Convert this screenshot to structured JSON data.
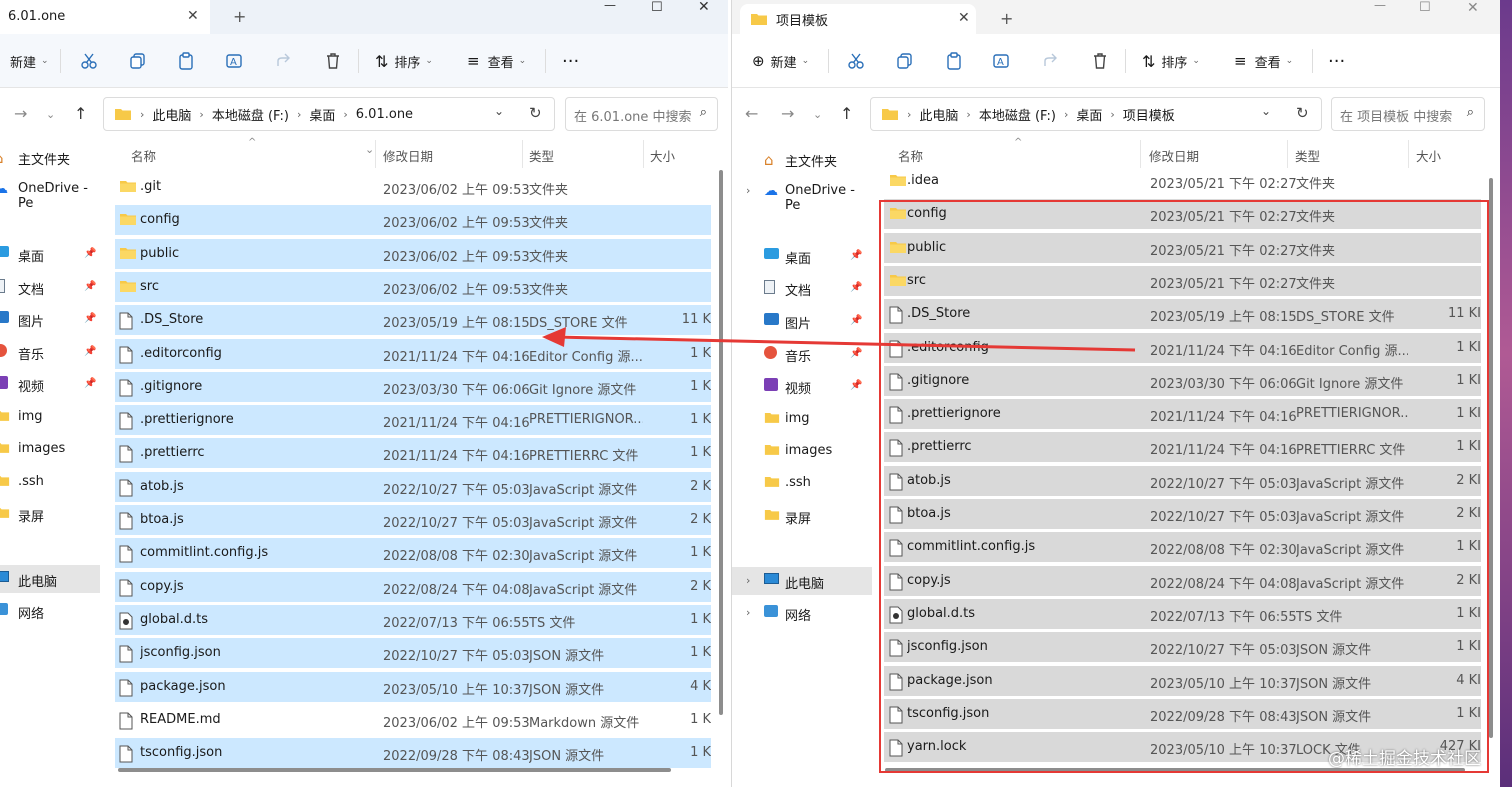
{
  "left": {
    "tab_title": "6.01.one",
    "toolbar": {
      "new": "新建",
      "sort": "排序",
      "view": "查看"
    },
    "breadcrumb": [
      "此电脑",
      "本地磁盘 (F:)",
      "桌面",
      "6.01.one"
    ],
    "search_placeholder": "在 6.01.one 中搜索",
    "sidebar": [
      {
        "label": "主文件夹",
        "icon": "home-icon",
        "pinned": false
      },
      {
        "label": "OneDrive - Pe",
        "icon": "cloud-icon",
        "pinned": false
      },
      {
        "label": "桌面",
        "icon": "desktop-icon",
        "pinned": true
      },
      {
        "label": "文档",
        "icon": "document-icon",
        "pinned": true
      },
      {
        "label": "图片",
        "icon": "picture-icon",
        "pinned": true
      },
      {
        "label": "音乐",
        "icon": "music-icon",
        "pinned": true
      },
      {
        "label": "视频",
        "icon": "video-icon",
        "pinned": true
      },
      {
        "label": "img",
        "icon": "folder-icon",
        "pinned": false
      },
      {
        "label": "images",
        "icon": "folder-icon",
        "pinned": false
      },
      {
        "label": ".ssh",
        "icon": "folder-icon",
        "pinned": false
      },
      {
        "label": "录屏",
        "icon": "folder-icon",
        "pinned": false
      },
      {
        "label": "此电脑",
        "icon": "computer-icon",
        "pinned": false
      },
      {
        "label": "网络",
        "icon": "network-icon",
        "pinned": false
      }
    ],
    "columns": {
      "name": "名称",
      "date": "修改日期",
      "type": "类型",
      "size": "大小"
    },
    "files": [
      {
        "name": ".git",
        "date": "2023/06/02 上午 09:53",
        "type": "文件夹",
        "size": "",
        "kind": "folder",
        "selected": false
      },
      {
        "name": "config",
        "date": "2023/06/02 上午 09:53",
        "type": "文件夹",
        "size": "",
        "kind": "folder",
        "selected": true
      },
      {
        "name": "public",
        "date": "2023/06/02 上午 09:53",
        "type": "文件夹",
        "size": "",
        "kind": "folder",
        "selected": true
      },
      {
        "name": "src",
        "date": "2023/06/02 上午 09:53",
        "type": "文件夹",
        "size": "",
        "kind": "folder",
        "selected": true
      },
      {
        "name": ".DS_Store",
        "date": "2023/05/19 上午 08:15",
        "type": "DS_STORE 文件",
        "size": "11 K",
        "kind": "file",
        "selected": true
      },
      {
        "name": ".editorconfig",
        "date": "2021/11/24 下午 04:16",
        "type": "Editor Config 源...",
        "size": "1 K",
        "kind": "file",
        "selected": true
      },
      {
        "name": ".gitignore",
        "date": "2023/03/30 下午 06:06",
        "type": "Git Ignore 源文件",
        "size": "1 K",
        "kind": "file",
        "selected": true
      },
      {
        "name": ".prettierignore",
        "date": "2021/11/24 下午 04:16",
        "type": "PRETTIERIGNOR...",
        "size": "1 K",
        "kind": "file",
        "selected": true
      },
      {
        "name": ".prettierrc",
        "date": "2021/11/24 下午 04:16",
        "type": "PRETTIERRC 文件",
        "size": "1 K",
        "kind": "file",
        "selected": true
      },
      {
        "name": "atob.js",
        "date": "2022/10/27 下午 05:03",
        "type": "JavaScript 源文件",
        "size": "2 K",
        "kind": "file",
        "selected": true
      },
      {
        "name": "btoa.js",
        "date": "2022/10/27 下午 05:03",
        "type": "JavaScript 源文件",
        "size": "2 K",
        "kind": "file",
        "selected": true
      },
      {
        "name": "commitlint.config.js",
        "date": "2022/08/08 下午 02:30",
        "type": "JavaScript 源文件",
        "size": "1 K",
        "kind": "file",
        "selected": true
      },
      {
        "name": "copy.js",
        "date": "2022/08/24 下午 04:08",
        "type": "JavaScript 源文件",
        "size": "2 K",
        "kind": "file",
        "selected": true
      },
      {
        "name": "global.d.ts",
        "date": "2022/07/13 下午 06:55",
        "type": "TS 文件",
        "size": "1 K",
        "kind": "ts",
        "selected": true
      },
      {
        "name": "jsconfig.json",
        "date": "2022/10/27 下午 05:03",
        "type": "JSON 源文件",
        "size": "1 K",
        "kind": "file",
        "selected": true
      },
      {
        "name": "package.json",
        "date": "2023/05/10 上午 10:37",
        "type": "JSON 源文件",
        "size": "4 K",
        "kind": "file",
        "selected": true
      },
      {
        "name": "README.md",
        "date": "2023/06/02 上午 09:53",
        "type": "Markdown 源文件",
        "size": "1 K",
        "kind": "file",
        "selected": false
      },
      {
        "name": "tsconfig.json",
        "date": "2022/09/28 下午 08:43",
        "type": "JSON 源文件",
        "size": "1 K",
        "kind": "file",
        "selected": true
      }
    ]
  },
  "right": {
    "tab_title": "项目模板",
    "toolbar": {
      "new": "新建",
      "sort": "排序",
      "view": "查看"
    },
    "breadcrumb": [
      "此电脑",
      "本地磁盘 (F:)",
      "桌面",
      "项目模板"
    ],
    "search_placeholder": "在 项目模板 中搜索",
    "sidebar": [
      {
        "label": "主文件夹",
        "icon": "home-icon",
        "pinned": false
      },
      {
        "label": "OneDrive - Pe",
        "icon": "cloud-icon",
        "pinned": false
      },
      {
        "label": "桌面",
        "icon": "desktop-icon",
        "pinned": true
      },
      {
        "label": "文档",
        "icon": "document-icon",
        "pinned": true
      },
      {
        "label": "图片",
        "icon": "picture-icon",
        "pinned": true
      },
      {
        "label": "音乐",
        "icon": "music-icon",
        "pinned": true
      },
      {
        "label": "视频",
        "icon": "video-icon",
        "pinned": true
      },
      {
        "label": "img",
        "icon": "folder-icon",
        "pinned": false
      },
      {
        "label": "images",
        "icon": "folder-icon",
        "pinned": false
      },
      {
        "label": ".ssh",
        "icon": "folder-icon",
        "pinned": false
      },
      {
        "label": "录屏",
        "icon": "folder-icon",
        "pinned": false
      },
      {
        "label": "此电脑",
        "icon": "computer-icon",
        "pinned": false
      },
      {
        "label": "网络",
        "icon": "network-icon",
        "pinned": false
      }
    ],
    "columns": {
      "name": "名称",
      "date": "修改日期",
      "type": "类型",
      "size": "大小"
    },
    "files": [
      {
        "name": ".idea",
        "date": "2023/05/21 下午 02:27",
        "type": "文件夹",
        "size": "",
        "kind": "folder",
        "selected": false
      },
      {
        "name": "config",
        "date": "2023/05/21 下午 02:27",
        "type": "文件夹",
        "size": "",
        "kind": "folder",
        "selected": true
      },
      {
        "name": "public",
        "date": "2023/05/21 下午 02:27",
        "type": "文件夹",
        "size": "",
        "kind": "folder",
        "selected": true
      },
      {
        "name": "src",
        "date": "2023/05/21 下午 02:27",
        "type": "文件夹",
        "size": "",
        "kind": "folder",
        "selected": true
      },
      {
        "name": ".DS_Store",
        "date": "2023/05/19 上午 08:15",
        "type": "DS_STORE 文件",
        "size": "11 KI",
        "kind": "file",
        "selected": true
      },
      {
        "name": ".editorconfig",
        "date": "2021/11/24 下午 04:16",
        "type": "Editor Config 源...",
        "size": "1 KI",
        "kind": "file",
        "selected": true
      },
      {
        "name": ".gitignore",
        "date": "2023/03/30 下午 06:06",
        "type": "Git Ignore 源文件",
        "size": "1 KI",
        "kind": "file",
        "selected": true
      },
      {
        "name": ".prettierignore",
        "date": "2021/11/24 下午 04:16",
        "type": "PRETTIERIGNOR...",
        "size": "1 KI",
        "kind": "file",
        "selected": true
      },
      {
        "name": ".prettierrc",
        "date": "2021/11/24 下午 04:16",
        "type": "PRETTIERRC 文件",
        "size": "1 KI",
        "kind": "file",
        "selected": true
      },
      {
        "name": "atob.js",
        "date": "2022/10/27 下午 05:03",
        "type": "JavaScript 源文件",
        "size": "2 KI",
        "kind": "file",
        "selected": true
      },
      {
        "name": "btoa.js",
        "date": "2022/10/27 下午 05:03",
        "type": "JavaScript 源文件",
        "size": "2 KI",
        "kind": "file",
        "selected": true
      },
      {
        "name": "commitlint.config.js",
        "date": "2022/08/08 下午 02:30",
        "type": "JavaScript 源文件",
        "size": "1 KI",
        "kind": "file",
        "selected": true
      },
      {
        "name": "copy.js",
        "date": "2022/08/24 下午 04:08",
        "type": "JavaScript 源文件",
        "size": "2 KI",
        "kind": "file",
        "selected": true
      },
      {
        "name": "global.d.ts",
        "date": "2022/07/13 下午 06:55",
        "type": "TS 文件",
        "size": "1 KI",
        "kind": "ts",
        "selected": true
      },
      {
        "name": "jsconfig.json",
        "date": "2022/10/27 下午 05:03",
        "type": "JSON 源文件",
        "size": "1 KI",
        "kind": "file",
        "selected": true
      },
      {
        "name": "package.json",
        "date": "2023/05/10 上午 10:37",
        "type": "JSON 源文件",
        "size": "4 KI",
        "kind": "file",
        "selected": true
      },
      {
        "name": "tsconfig.json",
        "date": "2022/09/28 下午 08:43",
        "type": "JSON 源文件",
        "size": "1 KI",
        "kind": "file",
        "selected": true
      },
      {
        "name": "yarn.lock",
        "date": "2023/05/10 上午 10:37",
        "type": "LOCK 文件",
        "size": "427 KI",
        "kind": "file",
        "selected": true
      }
    ]
  },
  "annotation_color": "#e53935",
  "watermark": "@稀土掘金技术社区"
}
